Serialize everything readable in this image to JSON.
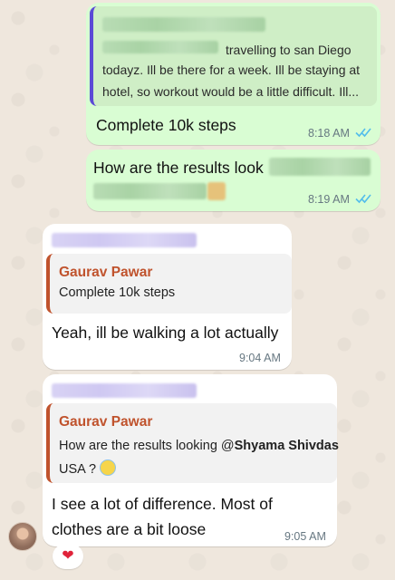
{
  "messages": [
    {
      "direction": "outgoing",
      "reply_preview_text_line1": "travelling to san Diego",
      "reply_preview_text_line2": "todayz. Ill be there for a week. Ill be staying at",
      "reply_preview_text_line3": "hotel, so workout would be a little difficult. Ill...",
      "text": "Complete 10k steps",
      "time": "8:18 AM",
      "status": "read"
    },
    {
      "direction": "outgoing",
      "text": "How are the results look",
      "time": "8:19 AM",
      "status": "read"
    },
    {
      "direction": "incoming",
      "quote_sender": "Gaurav Pawar",
      "quote_text": "Complete 10k steps",
      "text": "Yeah, ill be walking a lot actually",
      "time": "9:04 AM"
    },
    {
      "direction": "incoming",
      "quote_sender": "Gaurav Pawar",
      "quote_text_prefix": "How are the results looking @",
      "quote_mention": "Shyama Shivdas",
      "quote_text_line2": "USA ?",
      "text_line1": "I see a lot of difference. Most of",
      "text_line2": "clothes are a bit loose",
      "time": "9:05 AM"
    }
  ],
  "reaction": "❤",
  "colors": {
    "outgoing_bubble": "#d9fdd3",
    "incoming_bubble": "#ffffff",
    "quote_bar_outgoing": "#5b4ad6",
    "quote_sender": "#c0532d",
    "read_ticks": "#53bdeb",
    "timestamp": "#667781"
  },
  "icons": {
    "read_status": "double-check-icon",
    "reaction": "heart-icon",
    "emoji": "smiling-face-with-halo-icon"
  }
}
